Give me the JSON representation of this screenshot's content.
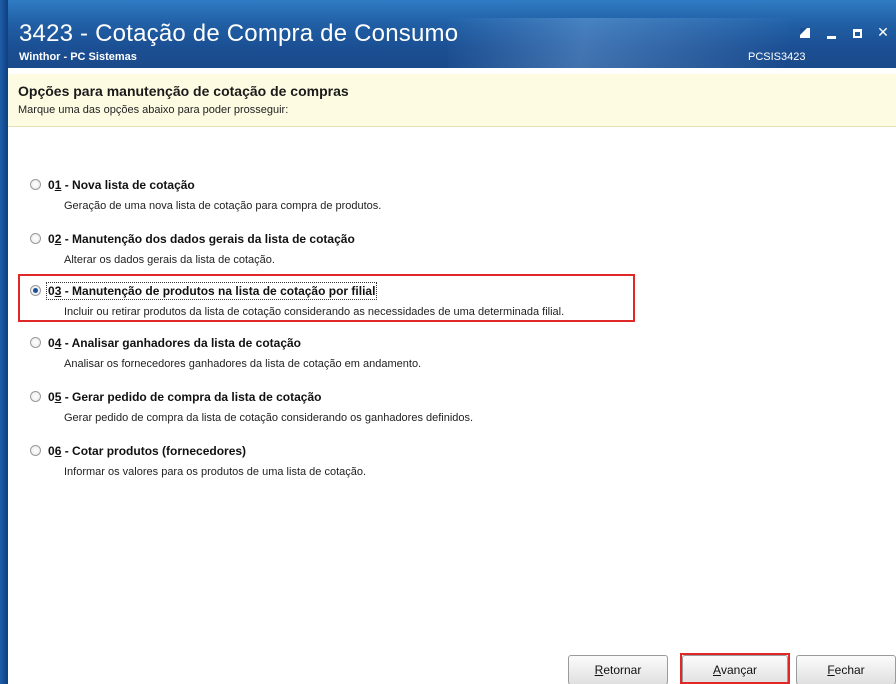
{
  "window": {
    "title": "3423 - Cotação de Compra de Consumo",
    "subtitle": "Winthor - PC Sistemas",
    "code": "PCSIS3423"
  },
  "header": {
    "title": "Opções para manutenção de cotação de compras",
    "subtitle": "Marque uma das opções abaixo para poder prosseguir:"
  },
  "options": [
    {
      "num_prefix": "0",
      "num_accel": "1",
      "label": " - Nova lista de cotação",
      "desc": "Geração de uma nova lista de cotação para compra de produtos.",
      "checked": false
    },
    {
      "num_prefix": "0",
      "num_accel": "2",
      "label": " - Manutenção dos dados gerais da lista de cotação",
      "desc": "Alterar os dados gerais da lista de cotação.",
      "checked": false
    },
    {
      "num_prefix": "0",
      "num_accel": "3",
      "label": " - Manutenção de produtos na lista de cotação por filial",
      "desc": "Incluir ou retirar produtos da lista de cotação considerando as necessidades de uma determinada filial.",
      "checked": true
    },
    {
      "num_prefix": "0",
      "num_accel": "4",
      "label": " - Analisar ganhadores da lista de cotação",
      "desc": "Analisar os fornecedores ganhadores da lista de cotação em andamento.",
      "checked": false
    },
    {
      "num_prefix": "0",
      "num_accel": "5",
      "label": " - Gerar pedido de compra da lista de cotação",
      "desc": "Gerar pedido de compra da lista de cotação considerando os ganhadores definidos.",
      "checked": false
    },
    {
      "num_prefix": "0",
      "num_accel": "6",
      "label": " - Cotar produtos (fornecedores)",
      "desc": "Informar os valores para os produtos de uma lista de cotação.",
      "checked": false
    }
  ],
  "buttons": {
    "back": {
      "accel": "R",
      "rest": "etornar"
    },
    "next": {
      "accel": "A",
      "rest": "vançar"
    },
    "close": {
      "accel": "F",
      "rest": "echar"
    }
  },
  "colors": {
    "titlebar": "#1b4f93",
    "header_bg": "#fdfce3",
    "highlight": "#e02828"
  }
}
